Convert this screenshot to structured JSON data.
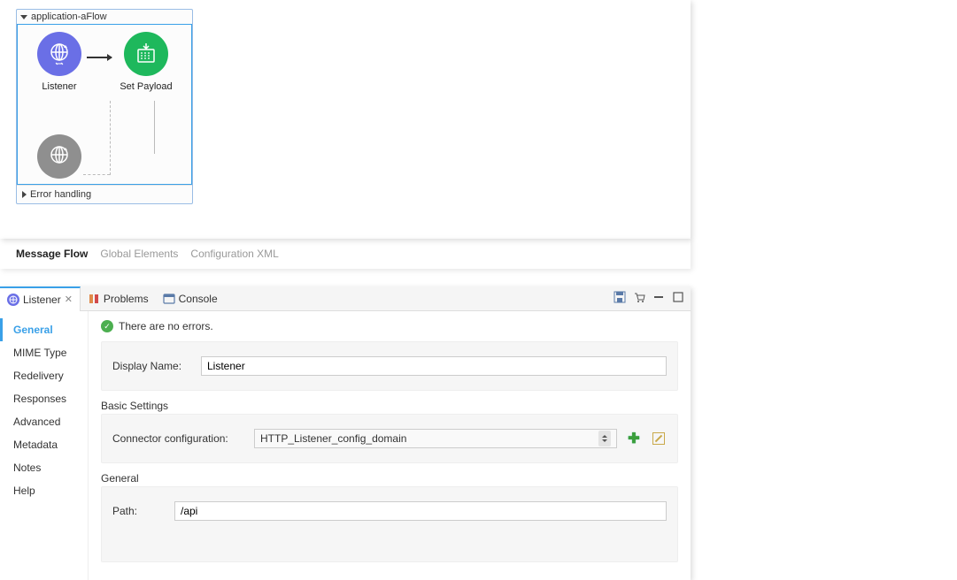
{
  "flow": {
    "title": "application-aFlow",
    "nodes": {
      "listener": {
        "label": "Listener"
      },
      "setpayload": {
        "label": "Set Payload"
      }
    },
    "error_section": "Error handling"
  },
  "editor_tabs": {
    "message_flow": "Message Flow",
    "global_elements": "Global Elements",
    "config_xml": "Configuration XML"
  },
  "panel": {
    "tabs": {
      "listener": "Listener",
      "problems": "Problems",
      "console": "Console"
    },
    "status": "There are no errors.",
    "side": {
      "general": "General",
      "mime": "MIME Type",
      "redelivery": "Redelivery",
      "responses": "Responses",
      "advanced": "Advanced",
      "metadata": "Metadata",
      "notes": "Notes",
      "help": "Help"
    },
    "form": {
      "display_name_label": "Display Name:",
      "display_name_value": "Listener",
      "basic_settings_title": "Basic Settings",
      "connector_label": "Connector configuration:",
      "connector_value": "HTTP_Listener_config_domain",
      "general_title": "General",
      "path_label": "Path:",
      "path_value": "/api"
    }
  }
}
